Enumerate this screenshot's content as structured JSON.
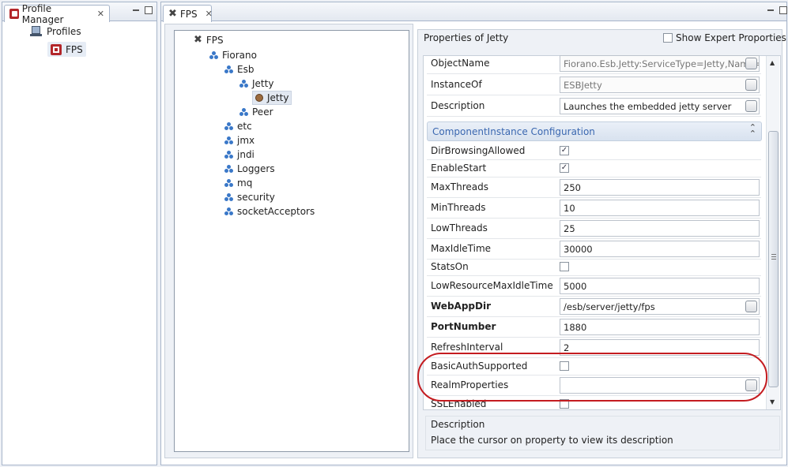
{
  "left_view": {
    "tab_label": "Profile Manager",
    "tree": [
      {
        "label": "Profiles"
      },
      {
        "label": "FPS"
      }
    ]
  },
  "editor": {
    "tab_label": "FPS",
    "tree": [
      {
        "label": "FPS"
      },
      {
        "label": "Fiorano"
      },
      {
        "label": "Esb"
      },
      {
        "label": "Jetty"
      },
      {
        "label": "Jetty"
      },
      {
        "label": "Peer"
      },
      {
        "label": "etc"
      },
      {
        "label": "jmx"
      },
      {
        "label": "jndi"
      },
      {
        "label": "Loggers"
      },
      {
        "label": "mq"
      },
      {
        "label": "security"
      },
      {
        "label": "socketAcceptors"
      }
    ]
  },
  "properties": {
    "title": "Properties of Jetty",
    "show_expert_label": "Show Expert Proporties",
    "general": [
      {
        "label": "ObjectName",
        "value": "Fiorano.Esb.Jetty:ServiceType=Jetty,Name="
      },
      {
        "label": "InstanceOf",
        "value": "ESBJetty"
      },
      {
        "label": "Description",
        "value": "Launches the embedded jetty server"
      }
    ],
    "section_title": "ComponentInstance Configuration",
    "config": [
      {
        "label": "DirBrowsingAllowed",
        "checked": true
      },
      {
        "label": "EnableStart",
        "checked": true
      },
      {
        "label": "MaxThreads",
        "value": "250"
      },
      {
        "label": "MinThreads",
        "value": "10"
      },
      {
        "label": "LowThreads",
        "value": "25"
      },
      {
        "label": "MaxIdleTime",
        "value": "30000"
      },
      {
        "label": "StatsOn",
        "checked": false
      },
      {
        "label": "LowResourceMaxIdleTime",
        "value": "5000"
      },
      {
        "label": "WebAppDir",
        "value": "/esb/server/jetty/fps"
      },
      {
        "label": "PortNumber",
        "value": "1880"
      },
      {
        "label": "RefreshInterval",
        "value": "2"
      },
      {
        "label": "BasicAuthSupported",
        "checked": false
      },
      {
        "label": "RealmProperties",
        "value": ""
      },
      {
        "label": "SSLEnabled",
        "checked": false
      }
    ],
    "description_box": {
      "title": "Description",
      "text": "Place the cursor on property to view its description"
    }
  },
  "colors": {
    "highlight_ellipse": "#c41c20",
    "section_header": "#dde6f2",
    "accent_link": "#3a67b0"
  }
}
